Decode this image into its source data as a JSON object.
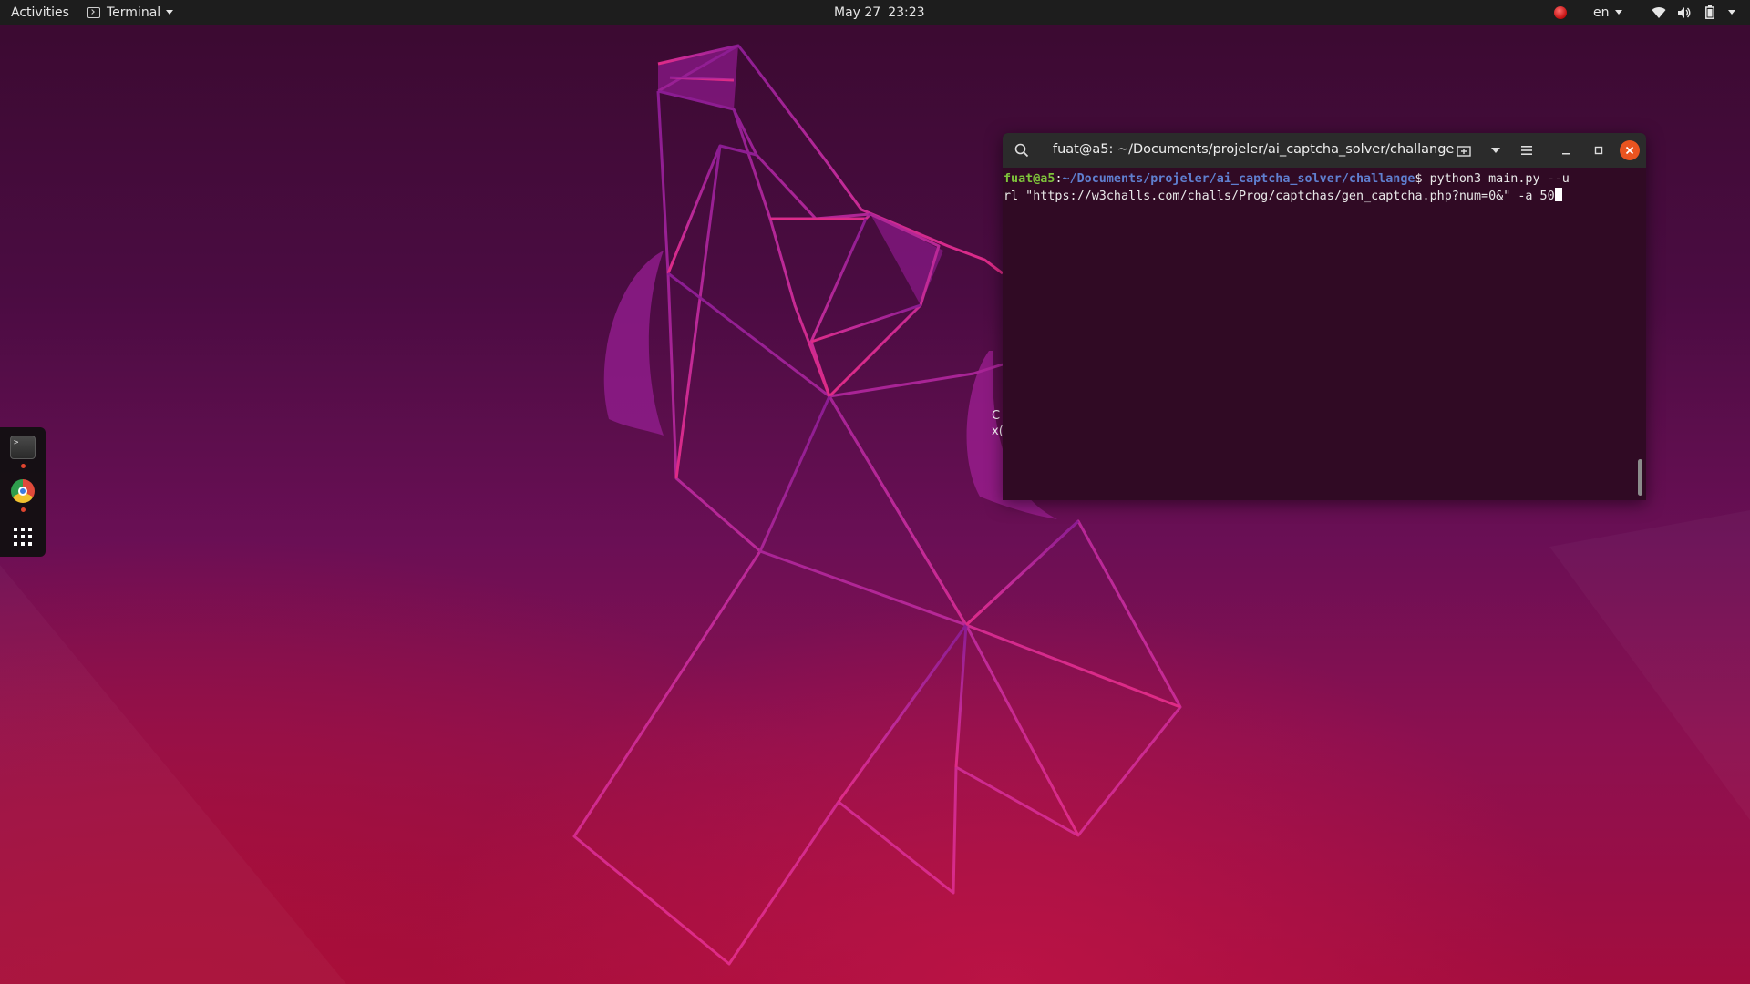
{
  "topbar": {
    "activities_label": "Activities",
    "app_menu_label": "Terminal",
    "clock_date": "May 27",
    "clock_time": "23:23",
    "language": "en"
  },
  "dock": {
    "items": [
      {
        "name": "Terminal",
        "icon": "terminal-icon",
        "running": true
      },
      {
        "name": "Google Chrome",
        "icon": "chrome-icon",
        "running": true
      },
      {
        "name": "Show Applications",
        "icon": "app-grid-icon",
        "running": false
      }
    ]
  },
  "desktop": {
    "partial_icon_label_line1": "C",
    "partial_icon_label_line2": "x("
  },
  "terminal": {
    "title": "fuat@a5: ~/Documents/projeler/ai_captcha_solver/challange",
    "prompt_user": "fuat@a5",
    "prompt_sep": ":",
    "prompt_path": "~/Documents/projeler/ai_captcha_solver/challange",
    "prompt_symbol": "$ ",
    "command_line1": "python3 main.py --u",
    "command_line2": "rl \"https://w3challs.com/challs/Prog/captchas/gen_captcha.php?num=0&\" -a 50"
  },
  "colors": {
    "topbar_bg": "#1d1d1d",
    "terminal_bg": "#300a24",
    "terminal_header_bg": "#2b2b2b",
    "prompt_user": "#7ec33b",
    "prompt_path": "#5f7fcf",
    "close_button": "#e95420"
  }
}
